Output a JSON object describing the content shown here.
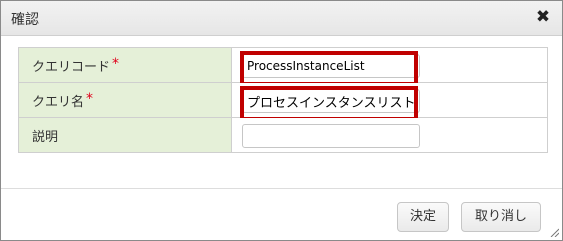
{
  "dialog": {
    "title": "確認",
    "close_icon": "close-icon"
  },
  "form": {
    "rows": [
      {
        "label": "クエリコード",
        "required": true,
        "required_mark": "*",
        "value": "ProcessInstanceList",
        "highlighted": true
      },
      {
        "label": "クエリ名",
        "required": true,
        "required_mark": "*",
        "value": "プロセスインスタンスリスト",
        "highlighted": true
      },
      {
        "label": "説明",
        "required": false,
        "required_mark": "",
        "value": "",
        "highlighted": false
      }
    ]
  },
  "buttons": {
    "ok_label": "決定",
    "cancel_label": "取り消し"
  },
  "colors": {
    "label_background": "#e5f0d8",
    "required_mark": "#e0001b",
    "highlight_border": "#c00000"
  }
}
